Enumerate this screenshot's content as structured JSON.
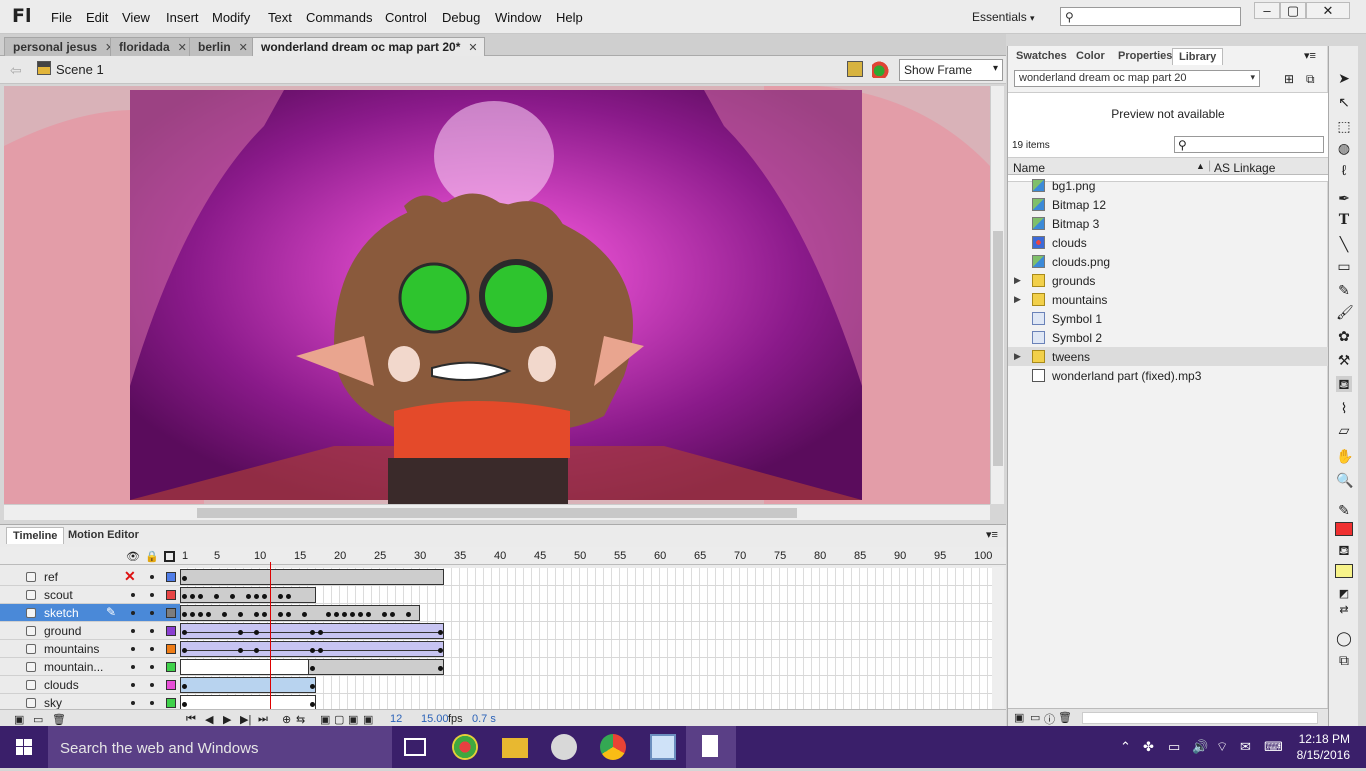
{
  "app": {
    "logo": "Fl"
  },
  "menu": [
    "File",
    "Edit",
    "View",
    "Insert",
    "Modify",
    "Text",
    "Commands",
    "Control",
    "Debug",
    "Window",
    "Help"
  ],
  "workspace": {
    "label": "Essentials"
  },
  "window_controls": {
    "minimize": "–",
    "maximize": "▢",
    "close": "✕"
  },
  "doc_tabs": [
    {
      "label": "personal jesus"
    },
    {
      "label": "floridada"
    },
    {
      "label": "berlin"
    },
    {
      "label": "wonderland dream oc map part 20*",
      "active": true
    }
  ],
  "scene": {
    "label": "Scene 1",
    "zoom": "Show Frame"
  },
  "timeline": {
    "tabs": [
      "Timeline",
      "Motion Editor"
    ],
    "frame_numbers": [
      "1",
      "5",
      "10",
      "15",
      "20",
      "25",
      "30",
      "35",
      "40",
      "45",
      "50",
      "55",
      "60",
      "65",
      "70",
      "75",
      "80",
      "85",
      "90",
      "95",
      "100"
    ],
    "current_frame": 12,
    "layers": [
      {
        "name": "ref",
        "color": "#4f7de8",
        "hidden": true
      },
      {
        "name": "scout",
        "color": "#e84545"
      },
      {
        "name": "sketch",
        "color": "#7d7d7d",
        "selected": true
      },
      {
        "name": "ground",
        "color": "#8a3fd1"
      },
      {
        "name": "mountains",
        "color": "#ef7d17"
      },
      {
        "name": "mountain...",
        "color": "#3fd14a"
      },
      {
        "name": "clouds",
        "color": "#e84fd8"
      },
      {
        "name": "sky",
        "color": "#3fd14a"
      }
    ],
    "footer": {
      "frame": "12",
      "fps": "15.00",
      "fps_unit": "fps",
      "time": "0.7 s"
    }
  },
  "library": {
    "tabs": [
      "Swatches",
      "Color",
      "Properties",
      "Library"
    ],
    "document": "wonderland dream oc map part 20",
    "preview": "Preview not available",
    "count": "19 items",
    "columns": {
      "name": "Name",
      "linkage": "AS Linkage"
    },
    "items": [
      {
        "name": "bg1.png",
        "type": "bitmap"
      },
      {
        "name": "Bitmap 12",
        "type": "bitmap"
      },
      {
        "name": "Bitmap 3",
        "type": "bitmap"
      },
      {
        "name": "clouds",
        "type": "symbol"
      },
      {
        "name": "clouds.png",
        "type": "bitmap"
      },
      {
        "name": "grounds",
        "type": "folder"
      },
      {
        "name": "mountains",
        "type": "folder"
      },
      {
        "name": "Symbol 1",
        "type": "graphic"
      },
      {
        "name": "Symbol 2",
        "type": "graphic"
      },
      {
        "name": "tweens",
        "type": "folder",
        "selected": true
      },
      {
        "name": "wonderland part (fixed).mp3",
        "type": "sound"
      }
    ]
  },
  "tools": {
    "stroke_color": "#ef3030",
    "fill_color": "#f7f38a"
  },
  "taskbar": {
    "search": "Search the web and Windows",
    "time": "12:18 PM",
    "date": "8/15/2016"
  }
}
